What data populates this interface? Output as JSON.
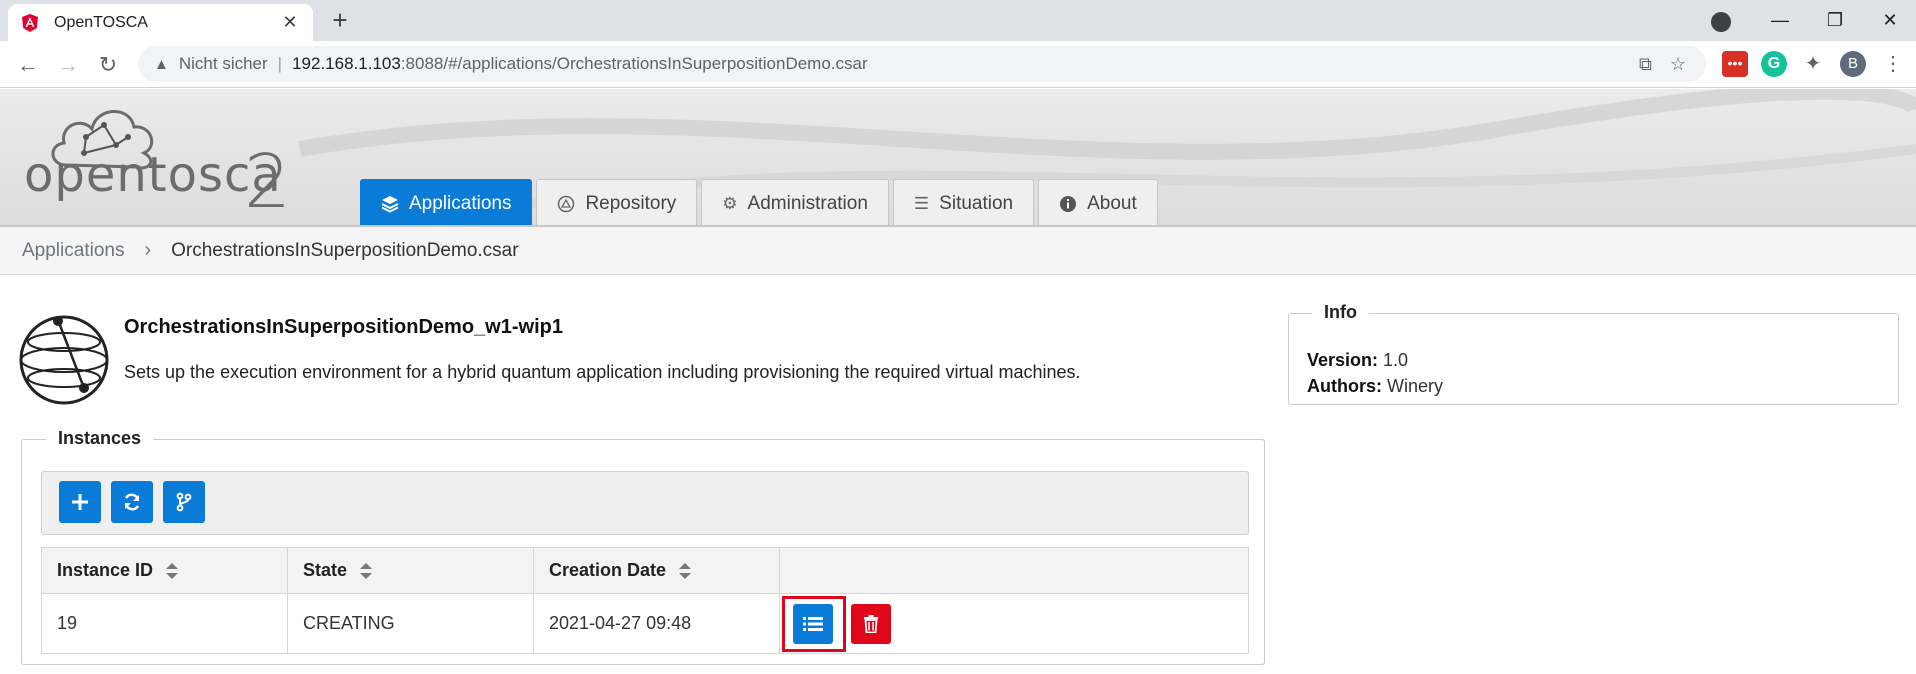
{
  "browser": {
    "tab_title": "OpenTOSCA",
    "security_label": "Nicht sicher",
    "url_host": "192.168.1.103",
    "url_path": ":8088/#/applications/OrchestrationsInSuperpositionDemo.csar",
    "profile_initial": "B"
  },
  "header": {
    "logo_text": "opentosca",
    "logo_number": "2",
    "nav": [
      {
        "label": "Applications",
        "icon": "layers-icon",
        "active": true
      },
      {
        "label": "Repository",
        "icon": "repository-icon",
        "active": false
      },
      {
        "label": "Administration",
        "icon": "gears-icon",
        "active": false
      },
      {
        "label": "Situation",
        "icon": "checklist-icon",
        "active": false
      },
      {
        "label": "About",
        "icon": "info-icon",
        "active": false
      }
    ]
  },
  "breadcrumb": {
    "root": "Applications",
    "current": "OrchestrationsInSuperpositionDemo.csar"
  },
  "application": {
    "title": "OrchestrationsInSuperpositionDemo_w1-wip1",
    "description": "Sets up the execution environment for a hybrid quantum application including provisioning the required virtual machines."
  },
  "info": {
    "legend": "Info",
    "version_label": "Version:",
    "version_value": "1.0",
    "authors_label": "Authors:",
    "authors_value": "Winery"
  },
  "instances": {
    "legend": "Instances",
    "columns": [
      "Instance ID",
      "State",
      "Creation Date"
    ],
    "rows": [
      {
        "id": "19",
        "state": "CREATING",
        "created": "2021-04-27 09:48"
      }
    ]
  },
  "colors": {
    "primary": "#0a7bd7",
    "danger": "#e0071a"
  }
}
